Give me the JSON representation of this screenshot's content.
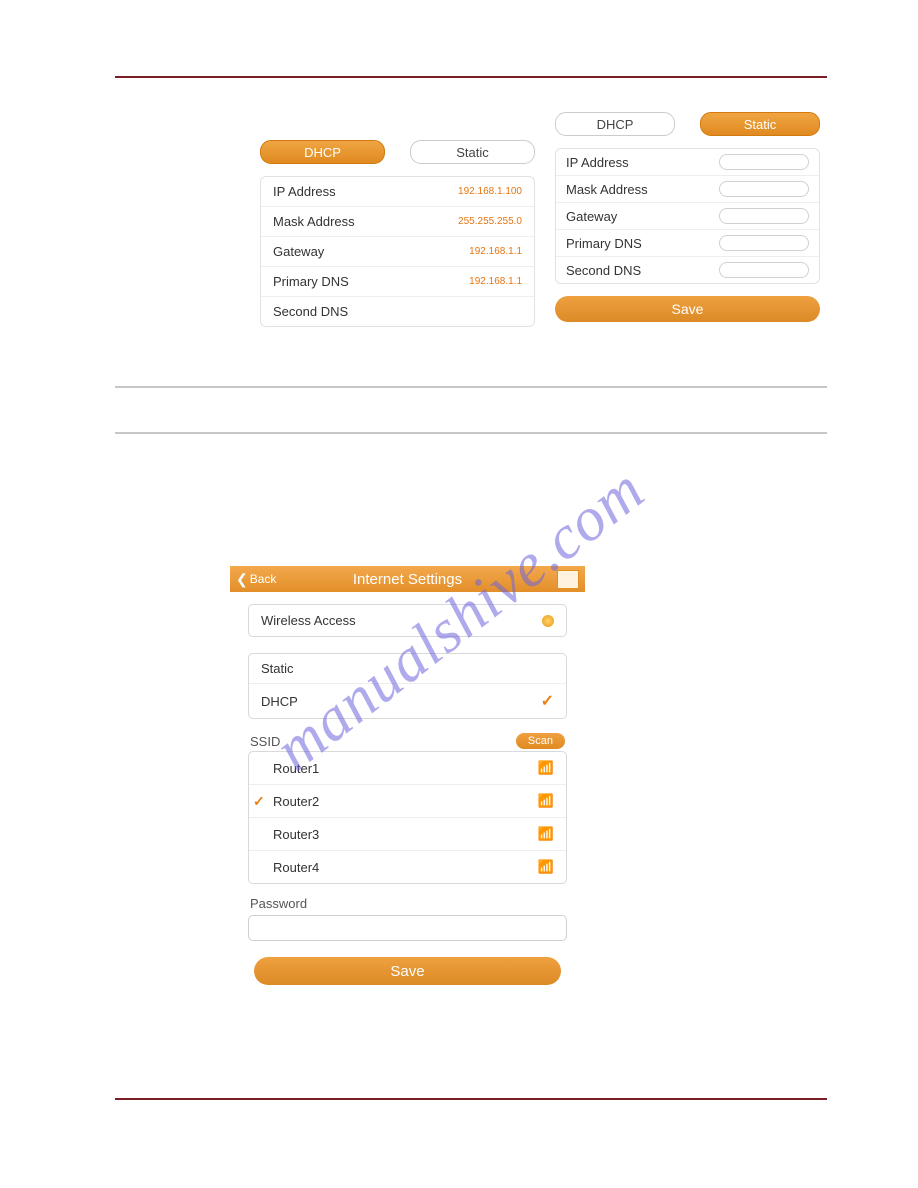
{
  "watermark": "manualshive.com",
  "top_left": {
    "tab_dhcp": "DHCP",
    "tab_static": "Static",
    "rows": [
      {
        "label": "IP Address",
        "value": "192.168.1.100"
      },
      {
        "label": "Mask Address",
        "value": "255.255.255.0"
      },
      {
        "label": "Gateway",
        "value": "192.168.1.1"
      },
      {
        "label": "Primary DNS",
        "value": "192.168.1.1"
      },
      {
        "label": "Second DNS",
        "value": ""
      }
    ]
  },
  "top_right": {
    "tab_dhcp": "DHCP",
    "tab_static": "Static",
    "rows": [
      {
        "label": "IP Address"
      },
      {
        "label": "Mask Address"
      },
      {
        "label": "Gateway"
      },
      {
        "label": "Primary DNS"
      },
      {
        "label": "Second DNS"
      }
    ],
    "save": "Save"
  },
  "bottom": {
    "back": "Back",
    "title": "Internet Settings",
    "wireless_access": "Wireless Access",
    "mode_static": "Static",
    "mode_dhcp": "DHCP",
    "ssid_label": "SSID",
    "scan": "Scan",
    "routers": [
      {
        "name": "Router1",
        "selected": false,
        "signal": "blue"
      },
      {
        "name": "Router2",
        "selected": true,
        "signal": "grey"
      },
      {
        "name": "Router3",
        "selected": false,
        "signal": "blue"
      },
      {
        "name": "Router4",
        "selected": false,
        "signal": "blue"
      }
    ],
    "password_label": "Password",
    "save": "Save"
  }
}
